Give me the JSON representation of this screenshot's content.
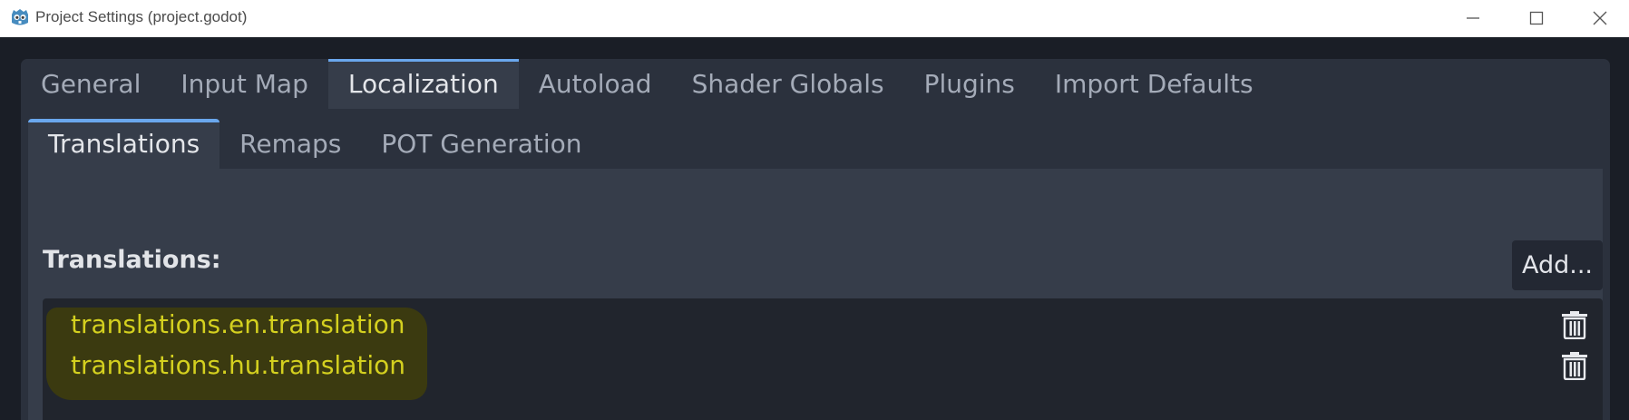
{
  "window": {
    "title": "Project Settings (project.godot)",
    "app_icon": "godot-icon",
    "controls": [
      "minimize-icon",
      "maximize-icon",
      "close-icon"
    ]
  },
  "tabs": [
    {
      "label": "General",
      "active": false
    },
    {
      "label": "Input Map",
      "active": false
    },
    {
      "label": "Localization",
      "active": true
    },
    {
      "label": "Autoload",
      "active": false
    },
    {
      "label": "Shader Globals",
      "active": false
    },
    {
      "label": "Plugins",
      "active": false
    },
    {
      "label": "Import Defaults",
      "active": false
    }
  ],
  "subtabs": [
    {
      "label": "Translations",
      "active": true
    },
    {
      "label": "Remaps",
      "active": false
    },
    {
      "label": "POT Generation",
      "active": false
    }
  ],
  "translations": {
    "heading": "Translations:",
    "add_label": "Add...",
    "items": [
      {
        "label": "translations.en.translation",
        "icon": "trash-icon"
      },
      {
        "label": "translations.hu.translation",
        "icon": "trash-icon"
      }
    ]
  },
  "colors": {
    "accent": "#6aa7ed",
    "panel": "#363d4a",
    "base": "#2b313d",
    "list_bg": "#21252d",
    "item_text": "#d4d01f",
    "highlight": "#3b3a10"
  }
}
